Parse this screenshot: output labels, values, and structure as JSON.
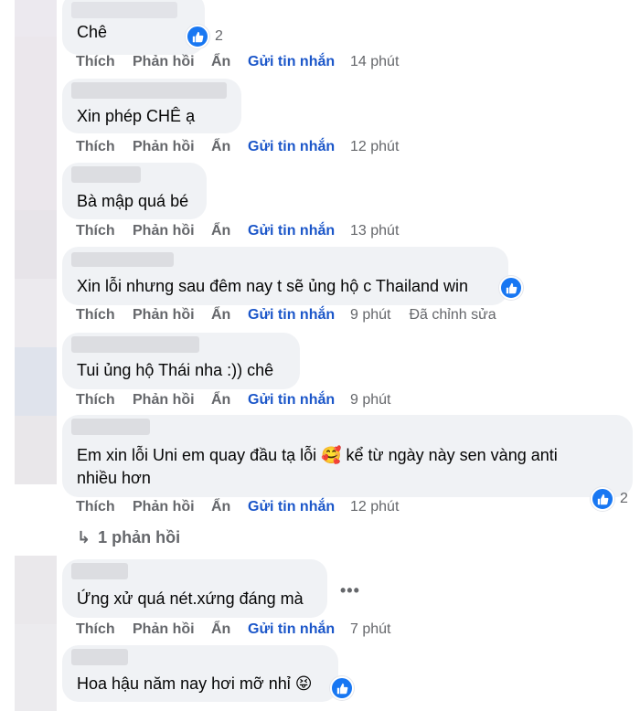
{
  "actions": {
    "like": "Thích",
    "reply": "Phản hồi",
    "hide": "Ẩn",
    "send": "Gửi tin nhắn"
  },
  "comments": [
    {
      "text": "Chê",
      "time": "14 phút",
      "reactions": "2"
    },
    {
      "text": "Xin phép CHÊ ạ",
      "time": "12 phút"
    },
    {
      "text": "Bà mập quá bé",
      "time": "13 phút"
    },
    {
      "text": "Xin lỗi nhưng sau đêm nay t sẽ ủng hộ c Thailand win",
      "time": "9 phút",
      "edited": "Đã chỉnh sửa"
    },
    {
      "text": "Tui ủng hộ Thái nha :)) chê",
      "time": "9 phút"
    },
    {
      "text_line1": "Em xin lỗi Uni em quay đầu tạ lỗi 🥰 kể từ ngày này sen vàng anti",
      "text_line2": "nhiều hơn",
      "time": "12 phút",
      "reactions": "2",
      "replies": "1 phản hồi"
    },
    {
      "text": "Ứng xử quá nét.xứng đáng mà",
      "time": "7 phút",
      "more": "•••"
    },
    {
      "text": "Hoa hậu năm nay hơi mỡ nhỉ 😝"
    }
  ],
  "icons": {
    "like": "thumbs-up-icon",
    "reply_arrow": "reply-arrow-icon",
    "more": "more-dots-icon"
  },
  "colors": {
    "bubble": "#f0f2f5",
    "like_blue": "#1877f2",
    "action_gray": "#65676b",
    "send_link": "#1b56c9"
  }
}
